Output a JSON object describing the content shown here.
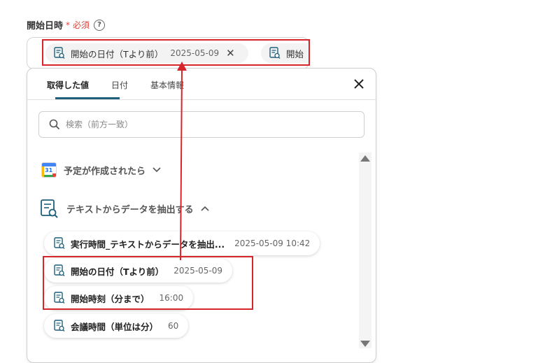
{
  "field": {
    "label": "開始日時",
    "required_mark": "*",
    "required_text": "必須",
    "help": "?"
  },
  "input": {
    "chip1": {
      "name": "開始の日付（Tより前）",
      "date": "2025-05-09"
    },
    "chip2": {
      "name": "開始"
    }
  },
  "panel": {
    "tabs": [
      "取得した値",
      "日付",
      "基本情報"
    ],
    "search_placeholder": "検索（前方一致）",
    "sections": [
      {
        "label": "予定が作成されたら",
        "icon": "google-calendar-icon",
        "calendar_day": "31"
      },
      {
        "label": "テキストからデータを抽出する",
        "icon": "document-search-icon"
      }
    ],
    "outputs": [
      {
        "name": "実行時間_テキストからデータを抽出...",
        "value": "2025-05-09 10:42"
      },
      {
        "name": "開始の日付（Tより前）",
        "value": "2025-05-09"
      },
      {
        "name": "開始時刻（分まで）",
        "value": "16:00"
      },
      {
        "name": "会議時間（単位は分）",
        "value": "60"
      }
    ]
  },
  "colors": {
    "accent": "#1f5f7a",
    "highlight": "#d6262b",
    "required": "#e0433a"
  }
}
